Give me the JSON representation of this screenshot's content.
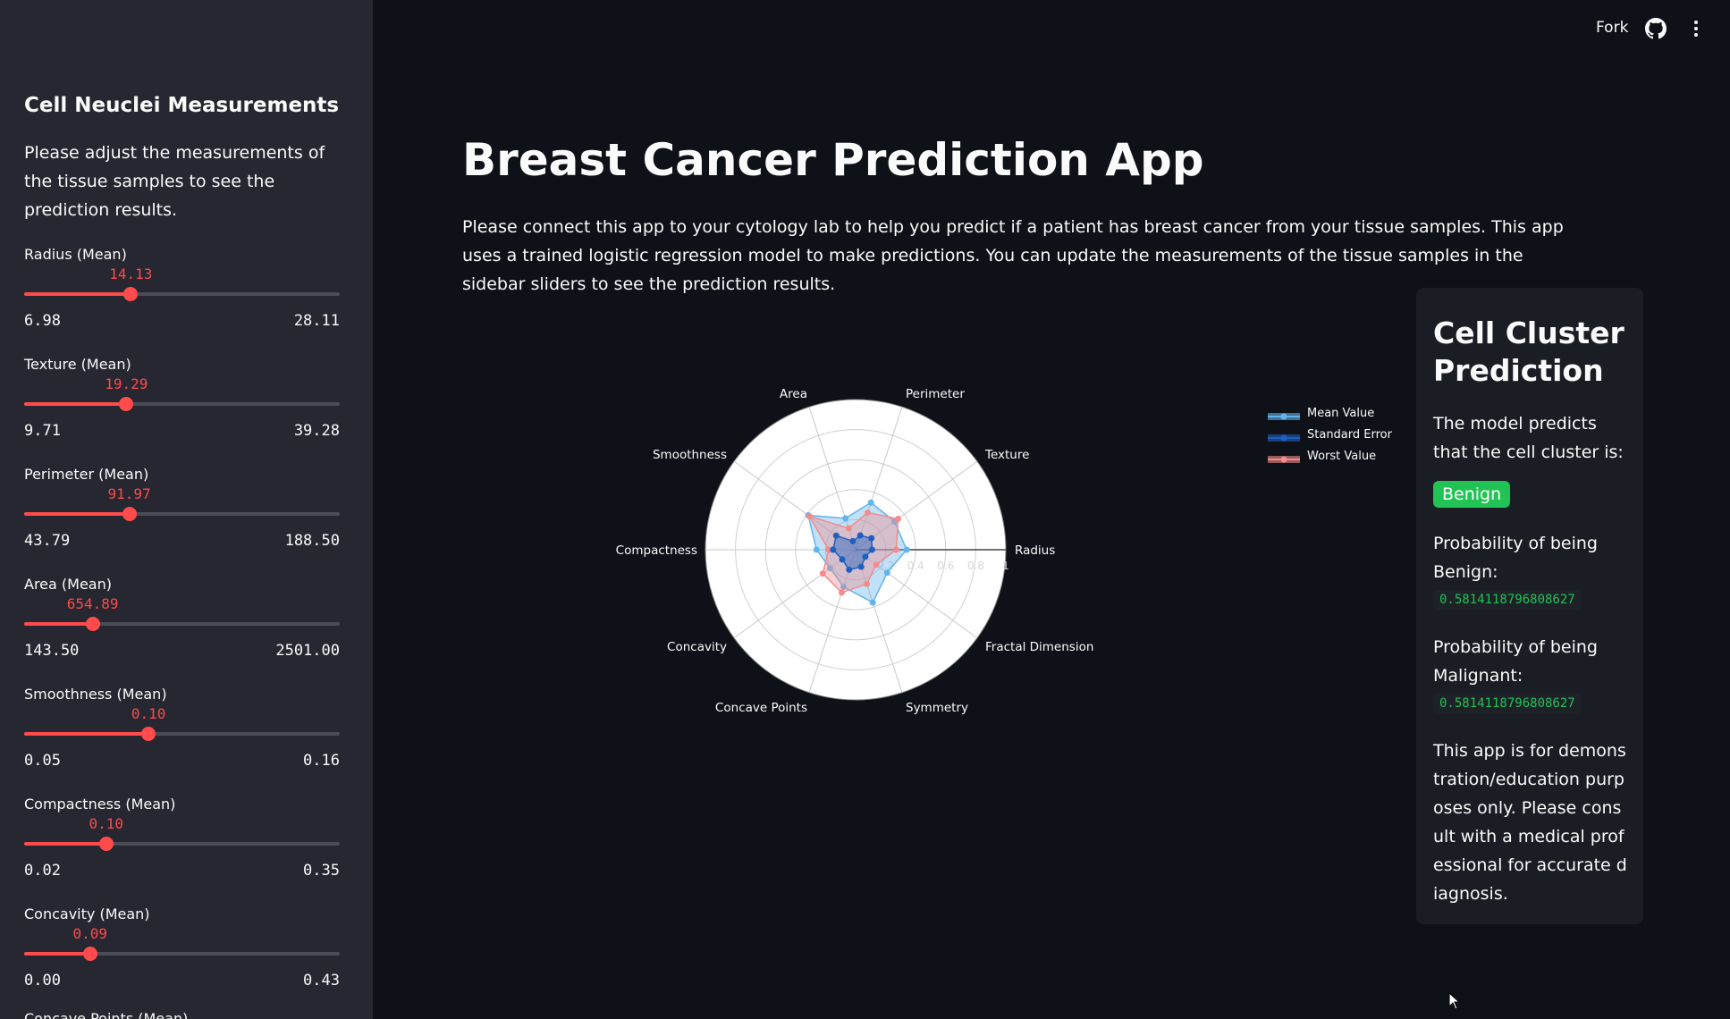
{
  "header": {
    "fork_label": "Fork"
  },
  "sidebar": {
    "title": "Cell Neuclei Measurements",
    "description": "Please adjust the measurements of the tissue samples to see the prediction results.",
    "sliders": [
      {
        "label": "Radius (Mean)",
        "value": "14.13",
        "min": "6.98",
        "max": "28.11",
        "fraction": 0.338
      },
      {
        "label": "Texture (Mean)",
        "value": "19.29",
        "min": "9.71",
        "max": "39.28",
        "fraction": 0.324
      },
      {
        "label": "Perimeter (Mean)",
        "value": "91.97",
        "min": "43.79",
        "max": "188.50",
        "fraction": 0.333
      },
      {
        "label": "Area (Mean)",
        "value": "654.89",
        "min": "143.50",
        "max": "2501.00",
        "fraction": 0.217
      },
      {
        "label": "Smoothness (Mean)",
        "value": "0.10",
        "min": "0.05",
        "max": "0.16",
        "fraction": 0.394
      },
      {
        "label": "Compactness (Mean)",
        "value": "0.10",
        "min": "0.02",
        "max": "0.35",
        "fraction": 0.26
      },
      {
        "label": "Concavity (Mean)",
        "value": "0.09",
        "min": "0.00",
        "max": "0.43",
        "fraction": 0.209
      }
    ],
    "cut_off_label": "Concave Points (Mean)"
  },
  "main": {
    "title": "Breast Cancer Prediction App",
    "description": "Please connect this app to your cytology lab to help you predict if a patient has breast cancer from your tissue samples. This app uses a trained logistic regression model to make predictions. You can update the measurements of the tissue samples in the sidebar sliders to see the prediction results."
  },
  "prediction": {
    "title": "Cell Cluster Prediction",
    "intro": "The model predicts that the cell cluster is:",
    "result": "Benign",
    "benign_label": "Probability of being Benign:",
    "benign_value": "0.5814118796808627",
    "malignant_label": "Probability of being Malignant:",
    "malignant_value": "0.5814118796808627",
    "note": "This app is for demonstration/education purposes only. Please consult with a medical professional for accurate diagnosis."
  },
  "colors": {
    "accent": "#ff4b4b",
    "benign": "#21c354",
    "mean": "#63b3ed",
    "se": "#1f5fbf",
    "worst": "#f28c8c"
  },
  "chart_data": {
    "type": "radar",
    "categories": [
      "Radius",
      "Texture",
      "Perimeter",
      "Area",
      "Smoothness",
      "Compactness",
      "Concavity",
      "Concave Points",
      "Symmetry",
      "Fractal Dimension"
    ],
    "radial_ticks": [
      "0",
      "0.2",
      "0.4",
      "0.6",
      "0.8",
      "1"
    ],
    "rlim": [
      0,
      1
    ],
    "legend_position": "top-right",
    "series": [
      {
        "name": "Mean Value",
        "values": [
          0.34,
          0.32,
          0.33,
          0.22,
          0.39,
          0.26,
          0.21,
          0.26,
          0.37,
          0.26
        ]
      },
      {
        "name": "Standard Error",
        "values": [
          0.11,
          0.13,
          0.1,
          0.06,
          0.16,
          0.15,
          0.11,
          0.14,
          0.12,
          0.08
        ]
      },
      {
        "name": "Worst Value",
        "values": [
          0.27,
          0.35,
          0.26,
          0.15,
          0.38,
          0.18,
          0.27,
          0.3,
          0.24,
          0.17
        ]
      }
    ]
  }
}
